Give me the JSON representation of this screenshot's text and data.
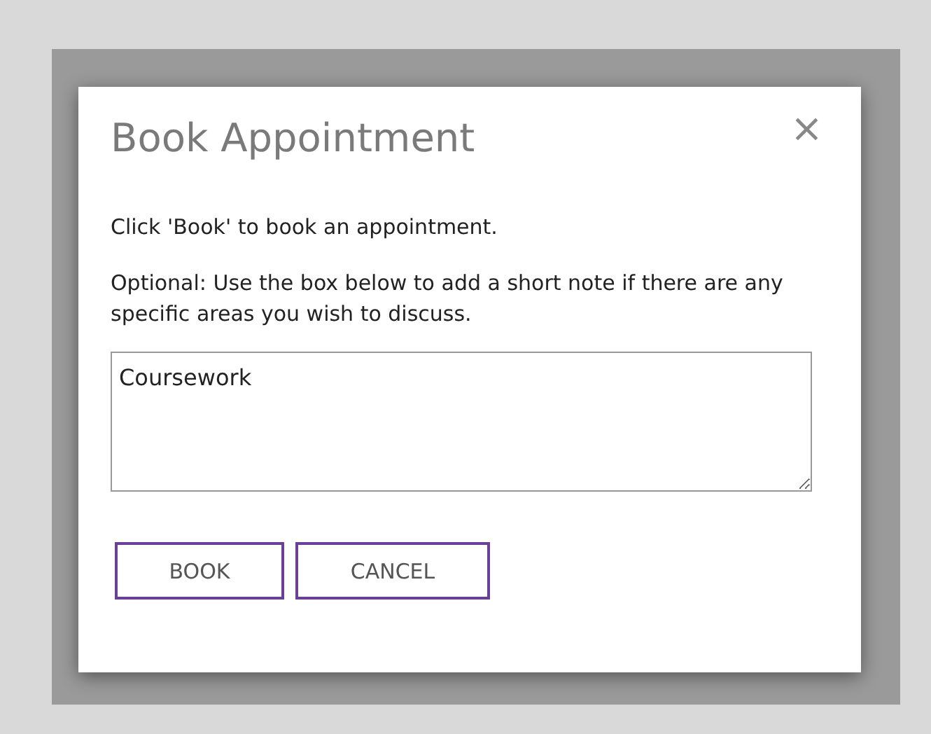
{
  "dialog": {
    "title": "Book Appointment",
    "close": "×",
    "paragraphs": [
      "Click 'Book' to book an appointment.",
      "Optional: Use the box below to add a short note if there are any specific areas you wish to discuss."
    ],
    "note": {
      "value": "Coursework"
    },
    "buttons": [
      "BOOK",
      "CANCEL"
    ]
  }
}
